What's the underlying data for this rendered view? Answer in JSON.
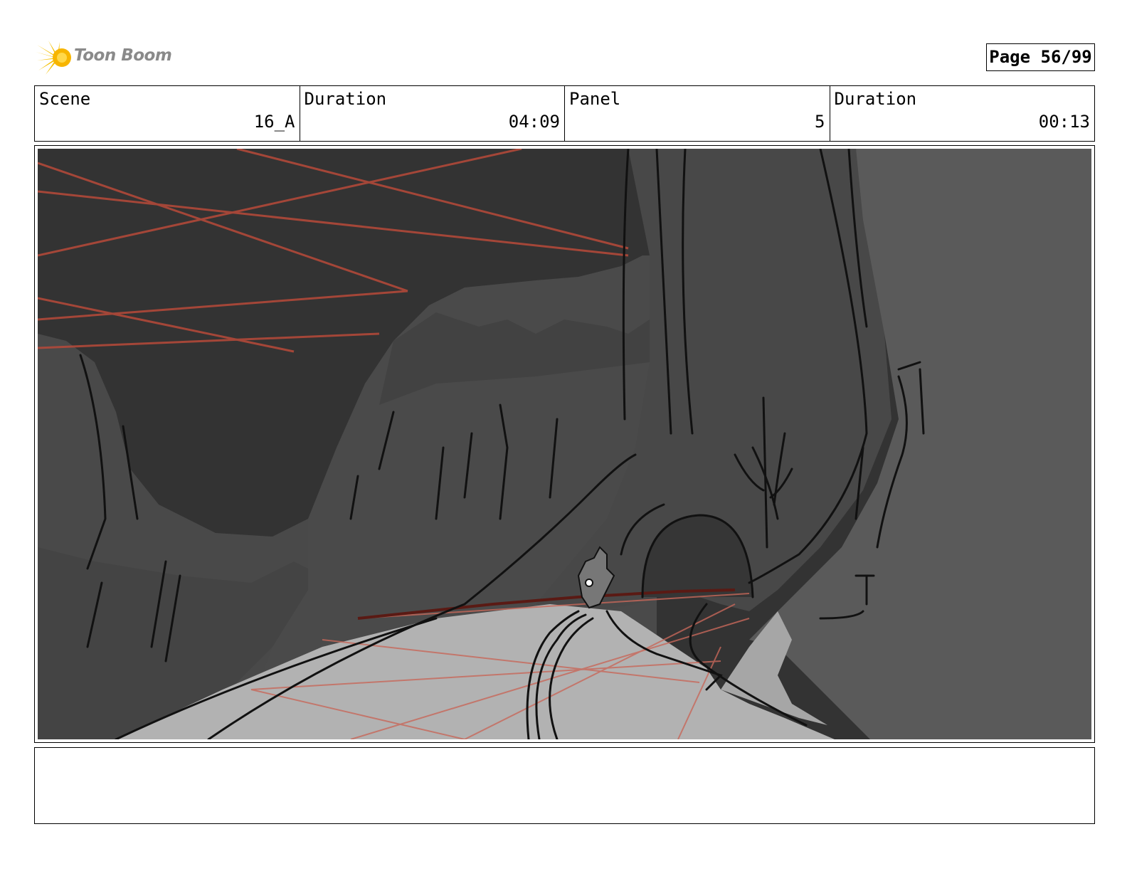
{
  "header": {
    "logo_text": "Toon Boom",
    "page_label": "Page 56/99"
  },
  "info": [
    {
      "label": "Scene",
      "value": "16_A"
    },
    {
      "label": "Duration",
      "value": "04:09"
    },
    {
      "label": "Panel",
      "value": "5"
    },
    {
      "label": "Duration",
      "value": "00:13"
    }
  ],
  "panel": {
    "description": ""
  },
  "colors": {
    "sky": "#333333",
    "cliff": "#4a4a4a",
    "right_cliff": "#5a5a5a",
    "road": "#b0b0b0",
    "perspective_lines": "#b84a3a",
    "logo_accent": "#f5c000"
  }
}
